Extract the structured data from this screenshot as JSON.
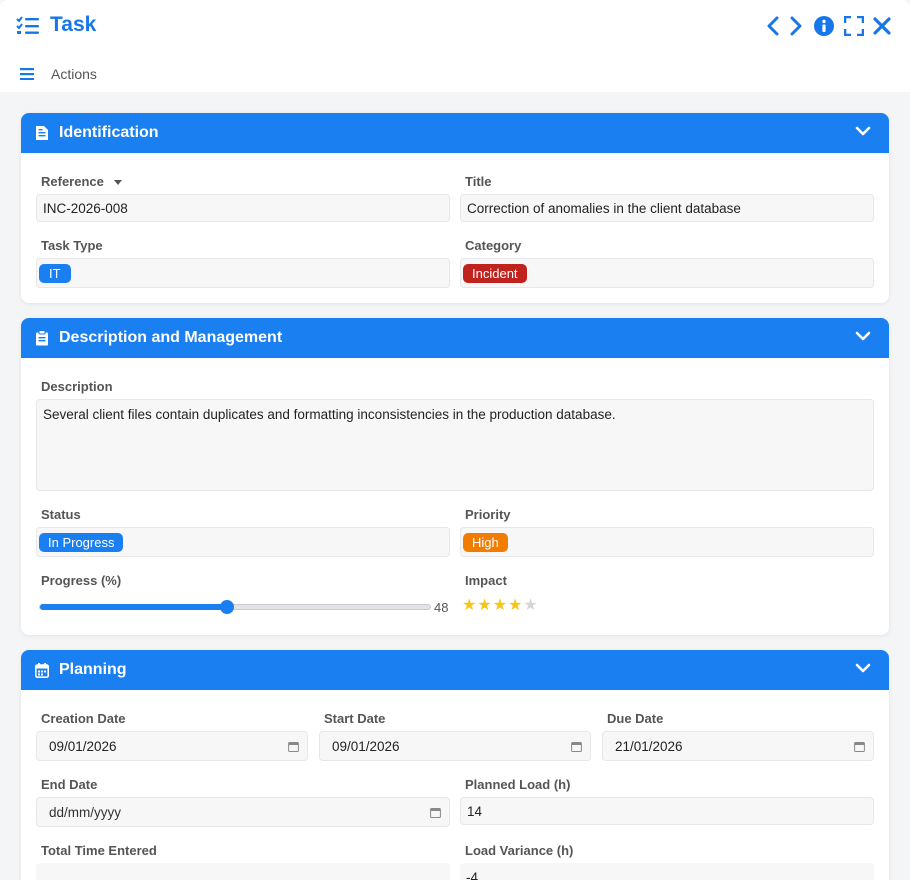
{
  "window": {
    "title": "Task",
    "actions_label": "Actions"
  },
  "colors": {
    "accent": "#1a7ff0",
    "it_tag": "#1a7ff0",
    "incident_tag": "#c0231e",
    "in_progress_tag": "#1a7ff0",
    "high_tag": "#f27c00",
    "star_on": "#f5c518",
    "star_off": "#d6d6d6"
  },
  "identification": {
    "title": "Identification",
    "reference_label": "Reference",
    "reference_value": "INC-2026-008",
    "title_label": "Title",
    "title_value": "Correction of anomalies in the client database",
    "task_type_label": "Task Type",
    "task_type_value": "IT",
    "category_label": "Category",
    "category_value": "Incident"
  },
  "description": {
    "title": "Description and Management",
    "description_label": "Description",
    "description_value": "Several client files contain duplicates and formatting inconsistencies in the production database.",
    "status_label": "Status",
    "status_value": "In Progress",
    "priority_label": "Priority",
    "priority_value": "High",
    "progress_label": "Progress (%)",
    "progress_value": 48,
    "impact_label": "Impact",
    "impact_rating": 4,
    "impact_max": 5
  },
  "planning": {
    "title": "Planning",
    "creation_date_label": "Creation Date",
    "creation_date_value": "09/01/2026",
    "start_date_label": "Start Date",
    "start_date_value": "09/01/2026",
    "due_date_label": "Due Date",
    "due_date_value": "21/01/2026",
    "end_date_label": "End Date",
    "end_date_placeholder": "dd/mm/yyyy",
    "planned_load_label": "Planned Load (h)",
    "planned_load_value": "14",
    "total_time_label": "Total Time Entered",
    "total_time_value": "",
    "load_variance_label": "Load Variance (h)",
    "load_variance_value": "-4"
  }
}
